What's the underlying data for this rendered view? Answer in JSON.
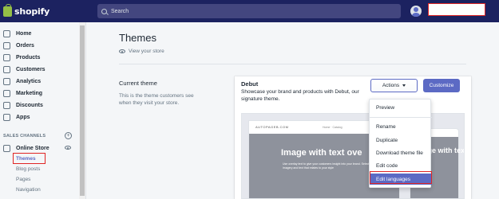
{
  "topbar": {
    "logo_text": "shopify",
    "search_placeholder": "Search"
  },
  "sidebar": {
    "items": [
      {
        "label": "Home",
        "icon": "home-icon"
      },
      {
        "label": "Orders",
        "icon": "orders-icon"
      },
      {
        "label": "Products",
        "icon": "products-icon"
      },
      {
        "label": "Customers",
        "icon": "customers-icon"
      },
      {
        "label": "Analytics",
        "icon": "analytics-icon"
      },
      {
        "label": "Marketing",
        "icon": "marketing-icon"
      },
      {
        "label": "Discounts",
        "icon": "discounts-icon"
      },
      {
        "label": "Apps",
        "icon": "apps-icon"
      }
    ],
    "sales_channels_heading": "SALES CHANNELS",
    "online_store_label": "Online Store",
    "sub_items": [
      "Themes",
      "Blog posts",
      "Pages",
      "Navigation"
    ]
  },
  "main": {
    "title": "Themes",
    "view_store": "View your store",
    "current_theme_heading": "Current theme",
    "current_theme_desc": "This is the theme customers see when they visit your store."
  },
  "card": {
    "theme_name": "Debut",
    "theme_desc": "Showcase your brand and products with Debut, our signature theme.",
    "actions_label": "Actions",
    "customize_label": "Customize",
    "preview": {
      "shop_name": "AUTOPAGEB.COM",
      "hero_title": "Image with text ove",
      "hero_sub": "Use overlay text to give your customers insight into your brand. Select imagery and text that relates to your style",
      "hero_title_mobile": "Image with text ov"
    }
  },
  "dropdown": {
    "items": [
      "Preview",
      "Rename",
      "Duplicate",
      "Download theme file",
      "Edit code",
      "Edit languages"
    ],
    "highlighted": "Edit languages",
    "accent": "#5c6ac4"
  },
  "colors": {
    "topbar": "#1c2260",
    "accent": "#5c6ac4",
    "highlight_box": "#e02525"
  }
}
